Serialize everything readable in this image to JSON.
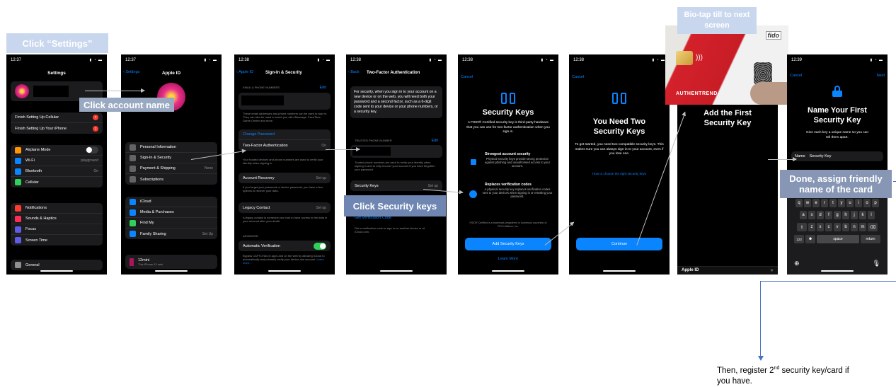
{
  "callouts": {
    "settings": "Click “Settings”",
    "account": "Click account name",
    "security_keys": "Click Security keys",
    "biotap": "Bio-tap till to next screen",
    "done": "Done, assign friendly name of the card"
  },
  "footer": {
    "pre": "Then, register 2",
    "sup": "nd",
    "post": " security key/card if you have."
  },
  "s1": {
    "time": "12:37",
    "title": "Settings",
    "rows_a": [
      {
        "label": "Finish Setting Up Cellular",
        "badge": "1"
      },
      {
        "label": "Finish Setting Up Your iPhone",
        "badge": "1"
      }
    ],
    "rows_b": [
      {
        "label": "Airplane Mode",
        "color": "#ff9500"
      },
      {
        "label": "Wi-Fi",
        "value": "playground",
        "color": "#0a84ff"
      },
      {
        "label": "Bluetooth",
        "value": "On",
        "color": "#0a84ff"
      },
      {
        "label": "Cellular",
        "color": "#30d158"
      }
    ],
    "rows_c": [
      {
        "label": "Notifications",
        "color": "#ff3b30"
      },
      {
        "label": "Sounds & Haptics",
        "color": "#ff2d55"
      },
      {
        "label": "Focus",
        "color": "#5e5ce6"
      },
      {
        "label": "Screen Time",
        "color": "#5e5ce6"
      }
    ],
    "rows_d": [
      {
        "label": "General",
        "color": "#8e8e93"
      }
    ]
  },
  "s2": {
    "time": "12:37",
    "back": "Settings",
    "title": "Apple ID",
    "rows_a": [
      {
        "label": "Personal Information"
      },
      {
        "label": "Sign-In & Security"
      },
      {
        "label": "Payment & Shipping",
        "value": "None"
      },
      {
        "label": "Subscriptions"
      }
    ],
    "rows_b": [
      {
        "label": "iCloud",
        "color": "#0a84ff"
      },
      {
        "label": "Media & Purchases",
        "color": "#0a84ff"
      },
      {
        "label": "Find My",
        "color": "#30d158"
      },
      {
        "label": "Family Sharing",
        "value": "Set Up",
        "color": "#0a84ff"
      }
    ],
    "device": "12mini",
    "device_sub": "This iPhone 12 mini"
  },
  "s3": {
    "time": "12:38",
    "back": "Apple ID",
    "title": "Sign-In & Security",
    "section": "EMAIL & PHONE NUMBERS",
    "edit": "Edit",
    "note1": "These email addresses and phone numbers can be used to sign in. They can also be used to reach you with iMessage, FaceTime, Game Center and more.",
    "change_pw": "Change Password",
    "tfa": "Two-Factor Authentication",
    "tfa_val": "On",
    "note2": "Your trusted devices and phone numbers are used to verify your identity when signing in.",
    "recovery": "Account Recovery",
    "recovery_val": "Set up",
    "note3": "If you forget your password or device passcode, you have a few options to recover your data.",
    "legacy": "Legacy Contact",
    "legacy_val": "Set up",
    "note4": "A legacy contact is someone you trust to have access to the data in your account after your death.",
    "advanced": "ADVANCED",
    "auto": "Automatic Verification",
    "note5": "Bypass CAPTCHAs in apps and on the web by allowing iCloud to automatically and privately verify your device and account.",
    "learn": "Learn more..."
  },
  "s4": {
    "time": "12:38",
    "back": "Back",
    "title": "Two-Factor Authentication",
    "intro": "For security, when you sign in to your account on a new device or on the web, you will need both your password and a second factor, such as a 6-digit code sent to your device or your phone numbers, or a security key.",
    "trusted": "TRUSTED PHONE NUMBER",
    "edit": "Edit",
    "note": "Trusted phone numbers are used to verify your identity when signing in and to help recover your account if you have forgotten your password.",
    "sec": "Security Keys",
    "sec_val": "Set up",
    "gvc": "Get Verification Code",
    "note2": "Get a verification code to sign in on another device or at iCloud.com."
  },
  "s5": {
    "time": "12:38",
    "cancel": "Cancel",
    "title": "Security Keys",
    "desc": "A FIDO® Certified security key is third-party hardware that you can use for two-factor authentication when you sign in.",
    "f1t": "Strongest account security",
    "f1d": "Physical security keys provide strong protection against phishing and unauthorised access to your account.",
    "f2t": "Replaces verification codes",
    "f2d": "A physical security key replaces verification codes sent to your devices when signing in or resetting your password.",
    "fido": "FIDO® Certified is a trademark (registered in numerous countries) of FIDO Alliance, Inc.",
    "add": "Add Security Keys",
    "learn": "Learn More"
  },
  "s6": {
    "time": "12:38",
    "cancel": "Cancel",
    "title": "You Need Two Security Keys",
    "desc": "To get started, you need two compatible security keys. This makes sure you can always sign in to your account, even if you lose one.",
    "link": "How to choose the right security keys",
    "cont": "Continue"
  },
  "s7": {
    "title": "Add the First Security Key",
    "bottom": "Apple ID",
    "card_brand": "AUTHENTREND",
    "card_logo": "fido"
  },
  "s8": {
    "time": "12:39",
    "cancel": "Cancel",
    "next": "Next",
    "title": "Name Your First Security Key",
    "desc": "Give each key a unique name so you can tell them apart.",
    "name_label": "Name",
    "name_value": "Security Key",
    "kb_row1": [
      "q",
      "w",
      "e",
      "r",
      "t",
      "y",
      "u",
      "i",
      "o",
      "p"
    ],
    "kb_row2": [
      "a",
      "s",
      "d",
      "f",
      "g",
      "h",
      "j",
      "k",
      "l"
    ],
    "kb_row3": [
      "z",
      "x",
      "c",
      "v",
      "b",
      "n",
      "m"
    ],
    "k123": "123",
    "space": "space",
    "ret": "return"
  },
  "colors": {
    "callout_light": "#c9d7ee",
    "callout_dark": "#7f92b3",
    "ios_blue": "#0a84ff",
    "toggle_green": "#30d158",
    "card_red": "#d4212b"
  }
}
